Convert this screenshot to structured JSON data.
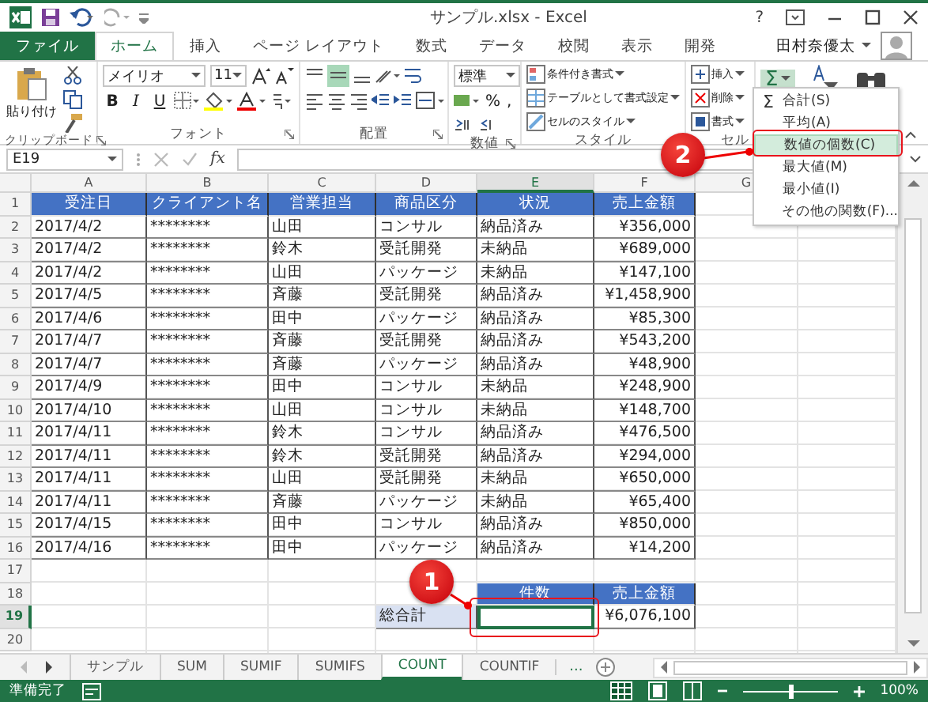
{
  "title_bar": {
    "title": "サンプル.xlsx - Excel",
    "help": "?"
  },
  "ribbon_tabs": [
    {
      "label": "ファイル",
      "kind": "file",
      "selected": false
    },
    {
      "label": "ホーム",
      "kind": "tab",
      "selected": true
    },
    {
      "label": "挿入",
      "kind": "tab",
      "selected": false
    },
    {
      "label": "ページ レイアウト",
      "kind": "tab",
      "selected": false
    },
    {
      "label": "数式",
      "kind": "tab",
      "selected": false
    },
    {
      "label": "データ",
      "kind": "tab",
      "selected": false
    },
    {
      "label": "校閲",
      "kind": "tab",
      "selected": false
    },
    {
      "label": "表示",
      "kind": "tab",
      "selected": false
    },
    {
      "label": "開発",
      "kind": "tab",
      "selected": false
    }
  ],
  "account": {
    "user": "田村奈優太"
  },
  "ribbon": {
    "clipboard": {
      "paste": "貼り付け",
      "label": "クリップボード"
    },
    "font": {
      "name": "メイリオ",
      "size": "11",
      "bold": "B",
      "italic": "I",
      "underline": "U",
      "label": "フォント"
    },
    "alignment": {
      "label": "配置"
    },
    "number": {
      "format": "標準",
      "percent": "%",
      "comma": ",",
      "label": "数値"
    },
    "styles": {
      "items": [
        "条件付き書式",
        "テーブルとして書式設定",
        "セルのスタイル"
      ],
      "label": "スタイル"
    },
    "cells": {
      "items": [
        "挿入",
        "削除",
        "書式"
      ],
      "label": "セル"
    },
    "editing": {
      "autosum": "Σ"
    }
  },
  "formula_bar": {
    "name_box": "E19",
    "fx": "fx"
  },
  "columns": [
    {
      "label": "A",
      "selected": false
    },
    {
      "label": "B",
      "selected": false
    },
    {
      "label": "C",
      "selected": false
    },
    {
      "label": "D",
      "selected": false
    },
    {
      "label": "E",
      "selected": true
    },
    {
      "label": "F",
      "selected": false
    },
    {
      "label": "G",
      "selected": false
    }
  ],
  "row_numbers": [
    {
      "label": "1",
      "selected": false
    },
    {
      "label": "2",
      "selected": false
    },
    {
      "label": "3",
      "selected": false
    },
    {
      "label": "4",
      "selected": false
    },
    {
      "label": "5",
      "selected": false
    },
    {
      "label": "6",
      "selected": false
    },
    {
      "label": "7",
      "selected": false
    },
    {
      "label": "8",
      "selected": false
    },
    {
      "label": "9",
      "selected": false
    },
    {
      "label": "10",
      "selected": false
    },
    {
      "label": "11",
      "selected": false
    },
    {
      "label": "12",
      "selected": false
    },
    {
      "label": "13",
      "selected": false
    },
    {
      "label": "14",
      "selected": false
    },
    {
      "label": "15",
      "selected": false
    },
    {
      "label": "16",
      "selected": false
    },
    {
      "label": "17",
      "selected": false
    },
    {
      "label": "18",
      "selected": false
    },
    {
      "label": "19",
      "selected": true
    },
    {
      "label": "20",
      "selected": false
    }
  ],
  "table": {
    "headers": [
      "受注日",
      "クライアント名",
      "営業担当",
      "商品区分",
      "状況",
      "売上金額"
    ],
    "rows": [
      [
        "2017/4/2",
        "********",
        "山田",
        "コンサル",
        "納品済み",
        "¥356,000"
      ],
      [
        "2017/4/2",
        "********",
        "鈴木",
        "受託開発",
        "未納品",
        "¥689,000"
      ],
      [
        "2017/4/2",
        "********",
        "山田",
        "パッケージ",
        "未納品",
        "¥147,100"
      ],
      [
        "2017/4/5",
        "********",
        "斉藤",
        "受託開発",
        "納品済み",
        "¥1,458,900"
      ],
      [
        "2017/4/6",
        "********",
        "田中",
        "パッケージ",
        "納品済み",
        "¥85,300"
      ],
      [
        "2017/4/7",
        "********",
        "斉藤",
        "受託開発",
        "納品済み",
        "¥543,200"
      ],
      [
        "2017/4/7",
        "********",
        "斉藤",
        "パッケージ",
        "納品済み",
        "¥48,900"
      ],
      [
        "2017/4/9",
        "********",
        "田中",
        "コンサル",
        "未納品",
        "¥248,900"
      ],
      [
        "2017/4/10",
        "********",
        "山田",
        "コンサル",
        "未納品",
        "¥148,700"
      ],
      [
        "2017/4/11",
        "********",
        "鈴木",
        "コンサル",
        "納品済み",
        "¥476,500"
      ],
      [
        "2017/4/11",
        "********",
        "鈴木",
        "受託開発",
        "納品済み",
        "¥294,000"
      ],
      [
        "2017/4/11",
        "********",
        "山田",
        "受託開発",
        "未納品",
        "¥650,000"
      ],
      [
        "2017/4/11",
        "********",
        "斉藤",
        "パッケージ",
        "未納品",
        "¥65,400"
      ],
      [
        "2017/4/15",
        "********",
        "田中",
        "コンサル",
        "納品済み",
        "¥850,000"
      ],
      [
        "2017/4/16",
        "********",
        "田中",
        "パッケージ",
        "納品済み",
        "¥14,200"
      ]
    ]
  },
  "summary": {
    "label": "総合計",
    "columns": [
      {
        "header": "件数",
        "selected": true
      },
      {
        "header": "売上金額",
        "value": "¥6,076,100",
        "selected": false
      }
    ]
  },
  "autosum_menu": [
    {
      "icon": "Σ",
      "label": "合計(S)",
      "selected": false
    },
    {
      "label": "平均(A)",
      "selected": false
    },
    {
      "label": "数値の個数(C)",
      "selected": true
    },
    {
      "label": "最大値(M)",
      "selected": false
    },
    {
      "label": "最小値(I)",
      "selected": false
    },
    {
      "label": "その他の関数(F)...",
      "selected": false
    }
  ],
  "callouts": [
    {
      "number": "1"
    },
    {
      "number": "2"
    }
  ],
  "sheet_tabs": [
    {
      "label": "サンプル",
      "selected": false
    },
    {
      "label": "SUM",
      "selected": false
    },
    {
      "label": "SUMIF",
      "selected": false
    },
    {
      "label": "SUMIFS",
      "selected": false
    },
    {
      "label": "COUNT",
      "selected": true
    },
    {
      "label": "COUNTIF",
      "selected": false
    }
  ],
  "sheet_more": "...",
  "status_bar": {
    "status": "準備完了",
    "zoom": "100%",
    "zoom_level": {
      "level": 0.5
    }
  }
}
